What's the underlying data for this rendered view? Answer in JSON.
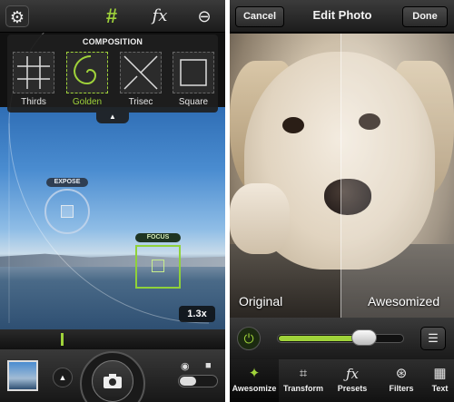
{
  "camera": {
    "composition_title": "COMPOSITION",
    "composition_items": [
      {
        "label": "Thirds"
      },
      {
        "label": "Golden"
      },
      {
        "label": "Trisec"
      },
      {
        "label": "Square"
      }
    ],
    "selected_composition": "Golden",
    "fx_label": "fx",
    "expose_label": "EXPOSE",
    "focus_label": "FOCUS",
    "zoom_label": "1.3x"
  },
  "editor": {
    "title": "Edit Photo",
    "cancel_label": "Cancel",
    "done_label": "Done",
    "original_label": "Original",
    "awesomized_label": "Awesomized",
    "slider_value": 0.73,
    "tabs": [
      {
        "label": "Awesomize",
        "icon": "awesomize-icon"
      },
      {
        "label": "Transform",
        "icon": "transform-icon"
      },
      {
        "label": "Presets",
        "icon": "fx-icon"
      },
      {
        "label": "Filters",
        "icon": "filters-icon"
      },
      {
        "label": "Text",
        "icon": "text-icon"
      }
    ]
  },
  "colors": {
    "accent": "#9fd23a",
    "toolbar": "#2a2a2a"
  }
}
